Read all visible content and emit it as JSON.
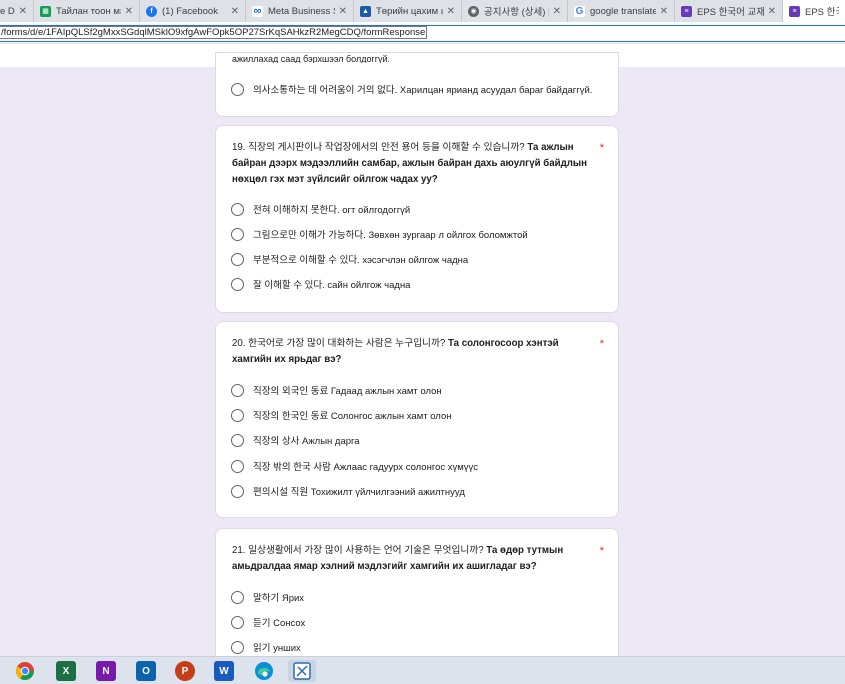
{
  "tabs": [
    {
      "title": "e Dr",
      "icon": "drive-icon",
      "color": "#1a73e8",
      "active": false
    },
    {
      "title": "Тайлан тоон мэдэ",
      "icon": "sheets-icon",
      "color": "#0f9d58",
      "active": false
    },
    {
      "title": "(1) Facebook",
      "icon": "facebook-icon",
      "color": "#1877f2",
      "active": false
    },
    {
      "title": "Meta Business Suit",
      "icon": "meta-icon",
      "color": "#0668e1",
      "active": false
    },
    {
      "title": "Төрийн цахим шуу",
      "icon": "emblem-icon",
      "color": "#1e5aa8",
      "active": false
    },
    {
      "title": "공지사항 (상세) | 외",
      "icon": "globe-icon",
      "color": "#5f6368",
      "active": false
    },
    {
      "title": "google translate - G",
      "icon": "google-icon",
      "color": "#4285f4",
      "active": false
    },
    {
      "title": "EPS 한국어 교재 게",
      "icon": "forms-icon",
      "color": "#673ab7",
      "active": false
    },
    {
      "title": "EPS 한국어",
      "icon": "forms-icon",
      "color": "#673ab7",
      "active": true
    }
  ],
  "address": {
    "url": "/forms/d/e/1FAIpQLSf2gMxxSGdqlMSklO9xfgAwFOpk5OP27SrKqSAHkzR2MegCDQ/formResponse"
  },
  "card18": {
    "partial_text": "ажиллахад саад бэрхшээл болдоггүй.",
    "option": "의사소통하는 데 어려움이 거의 없다. Харилцан ярианд асуудал бараг байдаггүй."
  },
  "q19": {
    "korean": "19. 직장의 게시판이나 작업장에서의 안전 용어 등을 이해할 수 있습니까?",
    "mongolian": "Та ажлын байран дээрх мэдээллийн самбар, ажлын байран дахь аюулгүй байдлын нөхцөл гэх мэт зүйлсийг ойлгож чадах уу?",
    "required": "*",
    "options": [
      "전혀 이해하지 못한다. огт ойлгодоггүй",
      "그림으로만 이해가 가능하다. Зөвхөн зургаар л ойлгох боломжтой",
      "부분적으로 이해할 수 있다. хэсэгчлэн ойлгож чадна",
      "잘 이해할 수 있다. сайн ойлгож чадна"
    ]
  },
  "q20": {
    "korean": "20. 한국어로 가장 많이 대화하는 사람은 누구입니까?",
    "mongolian": "Та солонгосоор хэнтэй хамгийн их ярьдаг вэ?",
    "required": "*",
    "options": [
      "직장의 외국인 동료 Гадаад ажлын хамт олон",
      "직장의 한국인 동료 Солонгос ажлын хамт олон",
      "직장의 상사 Ажлын дарга",
      "직장 밖의 한국 사람 Ажлаас гадуурх солонгос хүмүүс",
      "편의시설 직원 Тохижилт үйлчилгээний ажилтнууд"
    ]
  },
  "q21": {
    "korean": "21. 일상생활에서 가장 많이 사용하는 언어 기술은 무엇입니까?",
    "mongolian": "Та өдөр тутмын амьдралдаа ямар хэлний мэдлэгийг хамгийн их ашигладаг вэ?",
    "required": "*",
    "options": [
      "말하기 Ярих",
      "듣기 Сонсох",
      "읽기 унших"
    ]
  },
  "taskbar": [
    {
      "icon": "chrome-icon",
      "color": "#db4437",
      "glyph": ""
    },
    {
      "icon": "excel-icon",
      "color": "#1d6f42",
      "glyph": "X"
    },
    {
      "icon": "onenote-icon",
      "color": "#7719aa",
      "glyph": "N"
    },
    {
      "icon": "outlook-icon",
      "color": "#0a64ad",
      "glyph": "O"
    },
    {
      "icon": "powerpoint-icon",
      "color": "#c43e1c",
      "glyph": "P"
    },
    {
      "icon": "word-icon",
      "color": "#185abd",
      "glyph": "W"
    },
    {
      "icon": "edge-icon",
      "color": "#0c8ed9",
      "glyph": ""
    },
    {
      "icon": "snipping-tool-icon",
      "color": "#2b6cb0",
      "glyph": ""
    }
  ]
}
